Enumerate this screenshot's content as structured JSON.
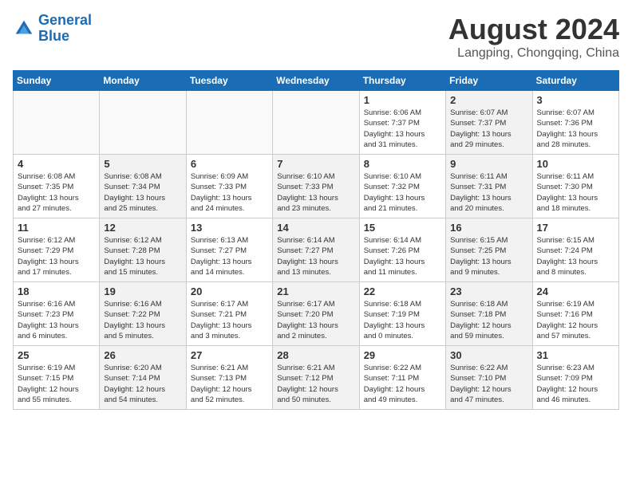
{
  "header": {
    "logo_line1": "General",
    "logo_line2": "Blue",
    "title": "August 2024",
    "subtitle": "Langping, Chongqing, China"
  },
  "days_of_week": [
    "Sunday",
    "Monday",
    "Tuesday",
    "Wednesday",
    "Thursday",
    "Friday",
    "Saturday"
  ],
  "weeks": [
    [
      {
        "num": "",
        "info": "",
        "shade": true
      },
      {
        "num": "",
        "info": "",
        "shade": true
      },
      {
        "num": "",
        "info": "",
        "shade": true
      },
      {
        "num": "",
        "info": "",
        "shade": true
      },
      {
        "num": "1",
        "info": "Sunrise: 6:06 AM\nSunset: 7:37 PM\nDaylight: 13 hours\nand 31 minutes."
      },
      {
        "num": "2",
        "info": "Sunrise: 6:07 AM\nSunset: 7:37 PM\nDaylight: 13 hours\nand 29 minutes.",
        "shade": true
      },
      {
        "num": "3",
        "info": "Sunrise: 6:07 AM\nSunset: 7:36 PM\nDaylight: 13 hours\nand 28 minutes."
      }
    ],
    [
      {
        "num": "4",
        "info": "Sunrise: 6:08 AM\nSunset: 7:35 PM\nDaylight: 13 hours\nand 27 minutes."
      },
      {
        "num": "5",
        "info": "Sunrise: 6:08 AM\nSunset: 7:34 PM\nDaylight: 13 hours\nand 25 minutes.",
        "shade": true
      },
      {
        "num": "6",
        "info": "Sunrise: 6:09 AM\nSunset: 7:33 PM\nDaylight: 13 hours\nand 24 minutes."
      },
      {
        "num": "7",
        "info": "Sunrise: 6:10 AM\nSunset: 7:33 PM\nDaylight: 13 hours\nand 23 minutes.",
        "shade": true
      },
      {
        "num": "8",
        "info": "Sunrise: 6:10 AM\nSunset: 7:32 PM\nDaylight: 13 hours\nand 21 minutes."
      },
      {
        "num": "9",
        "info": "Sunrise: 6:11 AM\nSunset: 7:31 PM\nDaylight: 13 hours\nand 20 minutes.",
        "shade": true
      },
      {
        "num": "10",
        "info": "Sunrise: 6:11 AM\nSunset: 7:30 PM\nDaylight: 13 hours\nand 18 minutes."
      }
    ],
    [
      {
        "num": "11",
        "info": "Sunrise: 6:12 AM\nSunset: 7:29 PM\nDaylight: 13 hours\nand 17 minutes."
      },
      {
        "num": "12",
        "info": "Sunrise: 6:12 AM\nSunset: 7:28 PM\nDaylight: 13 hours\nand 15 minutes.",
        "shade": true
      },
      {
        "num": "13",
        "info": "Sunrise: 6:13 AM\nSunset: 7:27 PM\nDaylight: 13 hours\nand 14 minutes."
      },
      {
        "num": "14",
        "info": "Sunrise: 6:14 AM\nSunset: 7:27 PM\nDaylight: 13 hours\nand 13 minutes.",
        "shade": true
      },
      {
        "num": "15",
        "info": "Sunrise: 6:14 AM\nSunset: 7:26 PM\nDaylight: 13 hours\nand 11 minutes."
      },
      {
        "num": "16",
        "info": "Sunrise: 6:15 AM\nSunset: 7:25 PM\nDaylight: 13 hours\nand 9 minutes.",
        "shade": true
      },
      {
        "num": "17",
        "info": "Sunrise: 6:15 AM\nSunset: 7:24 PM\nDaylight: 13 hours\nand 8 minutes."
      }
    ],
    [
      {
        "num": "18",
        "info": "Sunrise: 6:16 AM\nSunset: 7:23 PM\nDaylight: 13 hours\nand 6 minutes."
      },
      {
        "num": "19",
        "info": "Sunrise: 6:16 AM\nSunset: 7:22 PM\nDaylight: 13 hours\nand 5 minutes.",
        "shade": true
      },
      {
        "num": "20",
        "info": "Sunrise: 6:17 AM\nSunset: 7:21 PM\nDaylight: 13 hours\nand 3 minutes."
      },
      {
        "num": "21",
        "info": "Sunrise: 6:17 AM\nSunset: 7:20 PM\nDaylight: 13 hours\nand 2 minutes.",
        "shade": true
      },
      {
        "num": "22",
        "info": "Sunrise: 6:18 AM\nSunset: 7:19 PM\nDaylight: 13 hours\nand 0 minutes."
      },
      {
        "num": "23",
        "info": "Sunrise: 6:18 AM\nSunset: 7:18 PM\nDaylight: 12 hours\nand 59 minutes.",
        "shade": true
      },
      {
        "num": "24",
        "info": "Sunrise: 6:19 AM\nSunset: 7:16 PM\nDaylight: 12 hours\nand 57 minutes."
      }
    ],
    [
      {
        "num": "25",
        "info": "Sunrise: 6:19 AM\nSunset: 7:15 PM\nDaylight: 12 hours\nand 55 minutes."
      },
      {
        "num": "26",
        "info": "Sunrise: 6:20 AM\nSunset: 7:14 PM\nDaylight: 12 hours\nand 54 minutes.",
        "shade": true
      },
      {
        "num": "27",
        "info": "Sunrise: 6:21 AM\nSunset: 7:13 PM\nDaylight: 12 hours\nand 52 minutes."
      },
      {
        "num": "28",
        "info": "Sunrise: 6:21 AM\nSunset: 7:12 PM\nDaylight: 12 hours\nand 50 minutes.",
        "shade": true
      },
      {
        "num": "29",
        "info": "Sunrise: 6:22 AM\nSunset: 7:11 PM\nDaylight: 12 hours\nand 49 minutes."
      },
      {
        "num": "30",
        "info": "Sunrise: 6:22 AM\nSunset: 7:10 PM\nDaylight: 12 hours\nand 47 minutes.",
        "shade": true
      },
      {
        "num": "31",
        "info": "Sunrise: 6:23 AM\nSunset: 7:09 PM\nDaylight: 12 hours\nand 46 minutes."
      }
    ]
  ]
}
